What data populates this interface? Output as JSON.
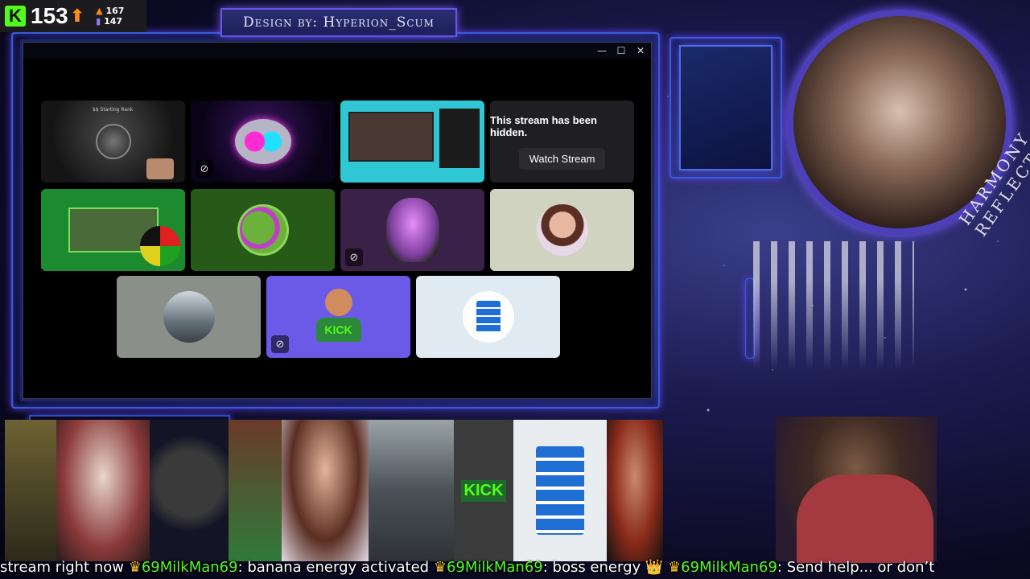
{
  "counter": {
    "logo": "K",
    "viewers": "153",
    "arrow": "🡑",
    "stat_up": "167",
    "stat_down": "147",
    "colors": {
      "kick_green": "#53fc18",
      "up": "#ff8c1a",
      "down": "#8f7bff"
    }
  },
  "banner": {
    "text": "Design by: Hyperion_Scum"
  },
  "window": {
    "controls": {
      "minimize": "—",
      "maximize": "☐",
      "close": "✕"
    },
    "tiles": [
      {
        "id": "t1",
        "kind": "video",
        "caption": "$$ Starting Rank"
      },
      {
        "id": "t2",
        "kind": "video"
      },
      {
        "id": "t3",
        "kind": "video"
      },
      {
        "id": "t4",
        "kind": "hidden",
        "message": "This stream has been hidden.",
        "button": "Watch Stream"
      },
      {
        "id": "t5",
        "kind": "video"
      },
      {
        "id": "t6",
        "kind": "avatar",
        "icon": "pepe-avatar"
      },
      {
        "id": "t7",
        "kind": "avatar",
        "icon": "alien-avatar",
        "muted": true
      },
      {
        "id": "t8",
        "kind": "avatar",
        "icon": "woman-avatar"
      },
      {
        "id": "t9",
        "kind": "avatar",
        "icon": "cathedral-avatar"
      },
      {
        "id": "t10",
        "kind": "avatar",
        "icon": "kick-mascot-avatar",
        "label": "KICK",
        "muted": true
      },
      {
        "id": "t11",
        "kind": "avatar",
        "icon": "tts-document-speaker-icon"
      }
    ]
  },
  "circle_art": {
    "text": "HARMONY REFLECTION"
  },
  "chat_ticker": {
    "messages": [
      {
        "user": "",
        "text": "stream right now"
      },
      {
        "user": "69MilkMan69",
        "text": "banana energy activated"
      },
      {
        "user": "69MilkMan69",
        "text": "boss energy 👑"
      },
      {
        "user": "69MilkMan69",
        "text": "Send help... or don’t"
      }
    ],
    "crown": "♛"
  },
  "bottom_strip": {
    "kick_label": "KICK"
  }
}
